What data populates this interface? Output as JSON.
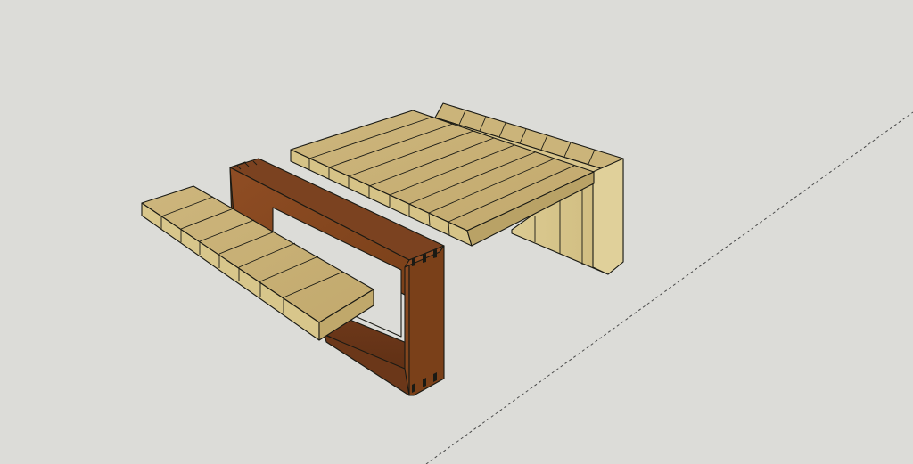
{
  "scene": {
    "background_color": "#dcdcd8",
    "wood_light_top": "#cbb37a",
    "wood_light_side": "#d9c88e",
    "wood_light_dark": "#b59e63",
    "wood_dark_front": "#8a4a22",
    "wood_dark_side": "#6e3a1a",
    "wood_dark_top": "#7a4220",
    "axis_color": "#4a4a4a",
    "models": [
      "bench-seat",
      "bench-frame",
      "table-top",
      "table-backrest"
    ]
  }
}
